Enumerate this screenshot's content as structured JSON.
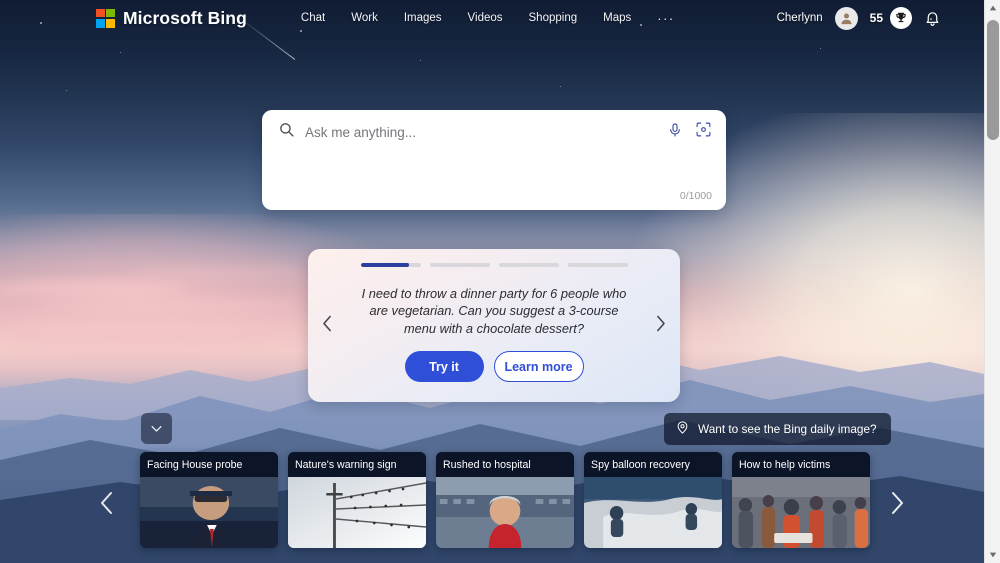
{
  "header": {
    "brand": "Microsoft Bing",
    "logo_icon": "microsoft-logo-icon",
    "logo_colors": [
      "#f25022",
      "#7fba00",
      "#00a4ef",
      "#ffb900"
    ],
    "nav": [
      {
        "label": "Chat"
      },
      {
        "label": "Work"
      },
      {
        "label": "Images"
      },
      {
        "label": "Videos"
      },
      {
        "label": "Shopping"
      },
      {
        "label": "Maps"
      }
    ],
    "more_label": "···",
    "user_name": "Cherlynn",
    "avatar_icon": "person-avatar-icon",
    "rewards_count": "55",
    "rewards_icon": "trophy-icon",
    "notifications_icon": "bell-icon",
    "menu_icon": "hamburger-menu-icon"
  },
  "search": {
    "placeholder": "Ask me anything...",
    "value": "",
    "search_icon": "search-icon",
    "mic_icon": "microphone-icon",
    "camera_icon": "visual-search-camera-icon",
    "char_count": "0/1000"
  },
  "promo": {
    "prompt": "I need to throw a dinner party for 6 people who are vegetarian. Can you suggest a 3-course menu with a chocolate dessert?",
    "try_label": "Try it",
    "learn_label": "Learn more",
    "prev_icon": "chevron-left-icon",
    "next_icon": "chevron-right-icon",
    "progress": [
      80,
      0,
      0,
      0
    ],
    "accent_color": "#2f4fd8",
    "progress_fill_color": "#2b3f9e"
  },
  "news": {
    "collapse_icon": "chevron-down-icon",
    "daily_image_label": "Want to see the Bing daily image?",
    "daily_image_icon": "location-pin-icon",
    "prev_icon": "chevron-left-icon",
    "next_icon": "chevron-right-icon",
    "cards": [
      {
        "title": "Facing House probe"
      },
      {
        "title": "Nature's warning sign"
      },
      {
        "title": "Rushed to hospital"
      },
      {
        "title": "Spy balloon recovery"
      },
      {
        "title": "How to help victims"
      }
    ]
  },
  "scrollbar": {
    "up_icon": "scroll-up-arrow-icon",
    "down_icon": "scroll-down-arrow-icon",
    "thumb": "scroll-thumb"
  }
}
